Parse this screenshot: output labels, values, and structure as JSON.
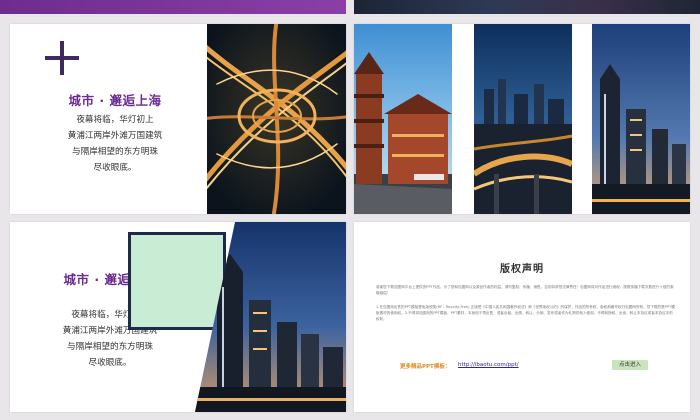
{
  "slides": {
    "city_slide_1": {
      "title": "城市 · 邂逅上海",
      "lines": [
        "夜幕将临，华灯初上",
        "黄浦江两岸外滩万国建筑",
        "与隔岸相望的东方明珠",
        "尽收眼底。"
      ]
    },
    "city_slide_2": {
      "title": "城市 · 邂逅上海",
      "lines": [
        "夜幕将临，华灯初上",
        "黄浦江两岸外滩万国建筑",
        "与隔岸相望的东方明珠",
        "尽收眼底。"
      ]
    },
    "copyright": {
      "title": "版权声明",
      "paragraph1": "感谢您下载包图网平台上提供的PPT作品，为了您和包图网以及原创作者的利益，请勿复制、传播、销售，否则将承担法律责任！包图网将对作品进行维权，按照传播下载次数进行十倍的索取赔偿！",
      "paragraph2": "1.在包图网出售的PPT模板是免版税类(RF：Royalty-Free) 正版受《中国人民共和国著作权法》和《世界版权公约》的保护，作品的所有权、版权和著作权归包图网所有，您下载的是PPT模板素材的使用权。2.不得将包图网的PPT模板、PPT素材，本身用于再出售，或者出租、出借、转让、分销、发布或者作为礼物供他人使用，不得转授权、出卖、转让本协议或者本协议中的权利。",
      "more_text": "更多精品PPT模板：",
      "link_text": "http://ibaotu.com/ppt/",
      "button_label": "点击进入"
    }
  },
  "colors": {
    "purple_accent": "#6a2c91",
    "button_green": "#c9e4bd",
    "mint_frame": "#c8ecd4"
  }
}
